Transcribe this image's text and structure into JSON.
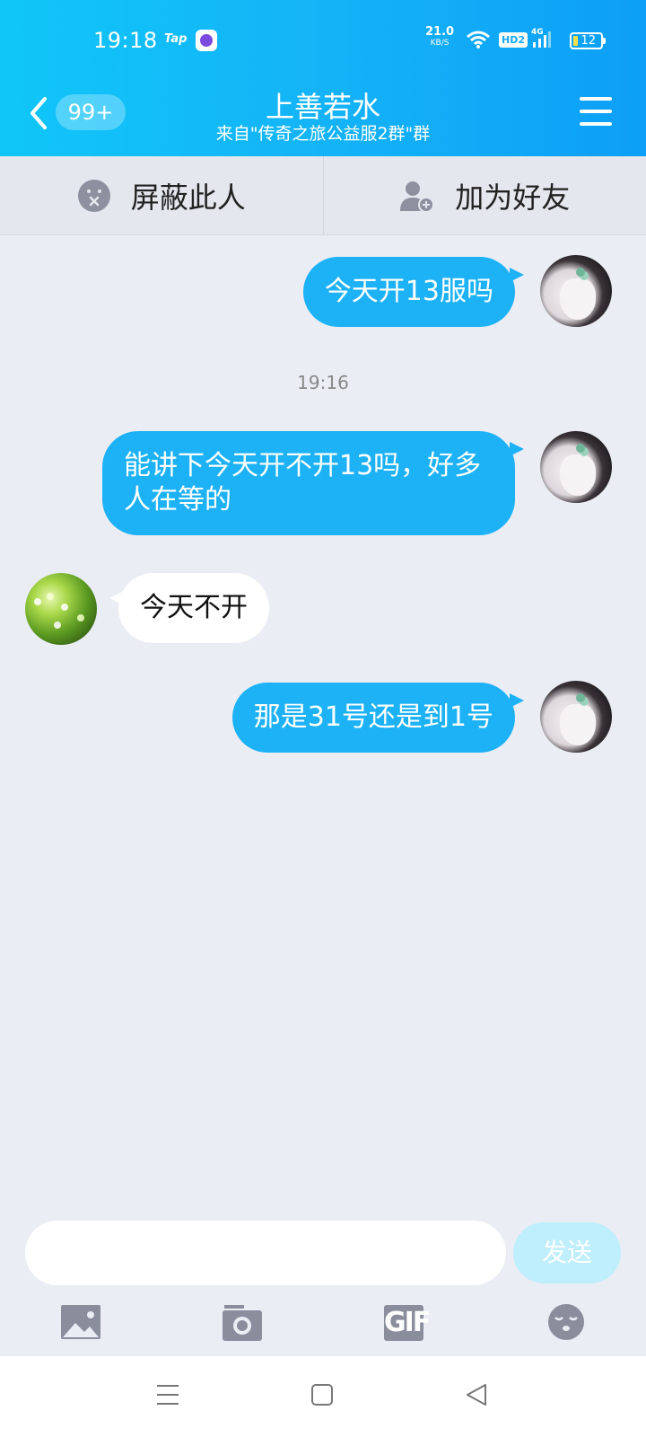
{
  "status_bar": {
    "time": "19:18",
    "tap_label": "Tap",
    "speed_value": "21.0",
    "speed_unit": "KB/S",
    "hd_label": "HD2",
    "network_label": "4G",
    "battery": "12"
  },
  "header": {
    "back_badge": "99+",
    "title": "上善若水",
    "subtitle": "来自\"传奇之旅公益服2群\"群"
  },
  "actions": {
    "block_label": "屏蔽此人",
    "add_friend_label": "加为好友"
  },
  "messages": [
    {
      "from": "me",
      "text": "今天开13服吗"
    },
    {
      "from": "me",
      "text": "能讲下今天开不开13吗，好多人在等的"
    },
    {
      "from": "other",
      "text": "今天不开"
    },
    {
      "from": "me",
      "text": "那是31号还是到1号"
    }
  ],
  "timestamp": "19:16",
  "composer": {
    "input_value": "",
    "send_label": "发送"
  },
  "toolbar": {
    "gif_label": "GIF",
    "icons": [
      "image-icon",
      "camera-icon",
      "gif-icon",
      "emoji-icon"
    ]
  },
  "colors": {
    "header": "#14b3f7",
    "my_bubble": "#1db2f6",
    "send_disabled": "#bfeefc",
    "background": "#ebedf5"
  }
}
